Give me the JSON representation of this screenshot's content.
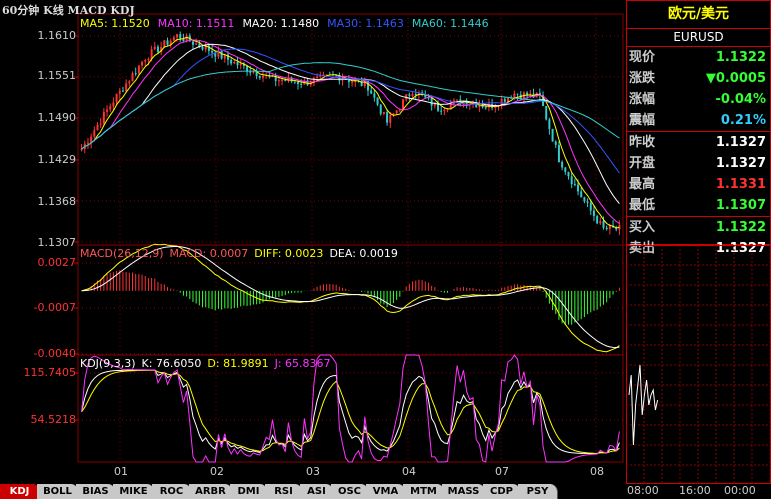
{
  "title": "60分钟 K线 MACD KDJ",
  "ma": [
    {
      "label": "MA5: 1.1520",
      "color": "#ffff00"
    },
    {
      "label": "MA10: 1.1511",
      "color": "#ff33ff"
    },
    {
      "label": "MA20: 1.1480",
      "color": "#ffffff"
    },
    {
      "label": "MA30: 1.1463",
      "color": "#3355ff"
    },
    {
      "label": "MA60: 1.1446",
      "color": "#33cccc"
    }
  ],
  "price_axis": [
    "1.1610",
    "1.1551",
    "1.1490",
    "1.1429",
    "1.1368",
    "1.1307"
  ],
  "macd": {
    "items": [
      {
        "label": "MACD(26,12,9)",
        "color": "#ff5555"
      },
      {
        "label": "MACD: 0.0007",
        "color": "#ff5555"
      },
      {
        "label": "DIFF: 0.0023",
        "color": "#ffff00"
      },
      {
        "label": "DEA: 0.0019",
        "color": "#ffffff"
      }
    ],
    "axis": [
      "0.0027",
      "-0.0007",
      "-0.0040"
    ]
  },
  "kdj": {
    "items": [
      {
        "label": "KDJ(9,3,3)",
        "color": "#ffffff"
      },
      {
        "label": "K: 76.6050",
        "color": "#ffffff"
      },
      {
        "label": "D: 81.9891",
        "color": "#ffff00"
      },
      {
        "label": "J: 65.8367",
        "color": "#ff33ff"
      }
    ],
    "axis": [
      "115.7405",
      "54.5218"
    ]
  },
  "x_axis": [
    "01",
    "02",
    "03",
    "04",
    "07",
    "08"
  ],
  "quote": {
    "name": "欧元/美元",
    "code": "EURUSD",
    "rows": [
      {
        "label": "现价",
        "value": "1.1322",
        "color": "#33ff33",
        "sep": false
      },
      {
        "label": "涨跌",
        "value": "▼0.0005",
        "color": "#33ff33",
        "sep": false
      },
      {
        "label": "涨幅",
        "value": "-0.04%",
        "color": "#33ff33",
        "sep": false
      },
      {
        "label": "震幅",
        "value": "0.21%",
        "color": "#33ccff",
        "sep": true
      },
      {
        "label": "昨收",
        "value": "1.1327",
        "color": "#ffffff",
        "sep": false
      },
      {
        "label": "开盘",
        "value": "1.1327",
        "color": "#ffffff",
        "sep": false
      },
      {
        "label": "最高",
        "value": "1.1331",
        "color": "#ff3333",
        "sep": false
      },
      {
        "label": "最低",
        "value": "1.1307",
        "color": "#33ff33",
        "sep": true
      },
      {
        "label": "买入",
        "value": "1.1322",
        "color": "#33ff33",
        "sep": false
      },
      {
        "label": "卖出",
        "value": "1.1327",
        "color": "#ffffff",
        "sep": false
      }
    ]
  },
  "time_axis": [
    "08:00",
    "16:00",
    "00:00"
  ],
  "tabs": [
    "KDJ",
    "BOLL",
    "BIAS",
    "MIKE",
    "ROC",
    "ARBR",
    "DMI",
    "RSI",
    "ASI",
    "OSC",
    "VMA",
    "MTM",
    "MASS",
    "CDP",
    "PSY"
  ],
  "active_tab": "KDJ",
  "colors": {
    "up": "#ff3333",
    "down": "#33cccc",
    "grid": "#880000"
  }
}
